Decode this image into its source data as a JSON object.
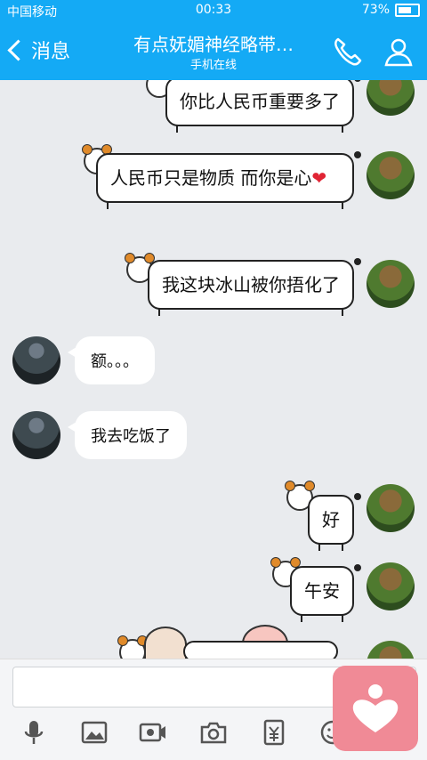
{
  "status": {
    "carrier": "中国移动",
    "time": "00:33",
    "battery": "73%"
  },
  "header": {
    "back_label": "消息",
    "title": "有点妩媚神经略带…",
    "subtitle": "手机在线"
  },
  "messages": [
    {
      "from": "me",
      "text": "你比人民币重要多了"
    },
    {
      "from": "me",
      "text": "人民币只是物质 而你是心"
    },
    {
      "from": "me",
      "text": "我这块冰山被你捂化了"
    },
    {
      "from": "them",
      "text": "额。。。"
    },
    {
      "from": "them",
      "text": "我去吃饭了"
    },
    {
      "from": "me",
      "text": "好"
    },
    {
      "from": "me",
      "text": "午安"
    }
  ],
  "icons": [
    "voice-icon",
    "image-icon",
    "video-icon",
    "camera-icon",
    "red-packet-icon",
    "emoji-icon"
  ],
  "colors": {
    "header": "#14aaf5",
    "heart": "#e02434",
    "floating": "#f08a96"
  }
}
